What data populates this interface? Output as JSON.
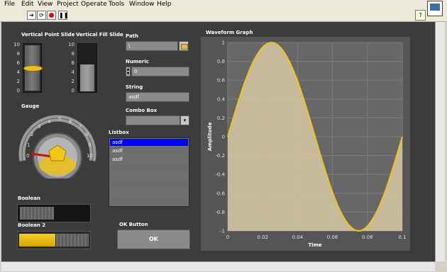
{
  "menu": [
    "File",
    "Edit",
    "View",
    "Project",
    "Operate",
    "Tools",
    "Window",
    "Help"
  ],
  "toolbar_icons": [
    "run-arrow-icon",
    "run-continuous-icon",
    "abort-icon",
    "pause-icon"
  ],
  "vertical_point_slide": {
    "label": "Vertical Point Slide",
    "ticks": [
      "10",
      "8",
      "6",
      "4",
      "2",
      "0"
    ],
    "value": 5
  },
  "vertical_fill_slide": {
    "label": "Vertical Fill Slide",
    "ticks": [
      "10",
      "8",
      "6",
      "4",
      "2",
      "0"
    ],
    "value": 6
  },
  "gauge": {
    "label": "Gauge",
    "ticks": [
      "0",
      "1",
      "2",
      "3",
      "4",
      "5",
      "6",
      "7",
      "8",
      "9",
      "10"
    ],
    "value": 1.4
  },
  "path": {
    "label": "Path",
    "value": "\\"
  },
  "numeric": {
    "label": "Numeric",
    "value": "0"
  },
  "string": {
    "label": "String",
    "value": "asdf"
  },
  "combo_box": {
    "label": "Combo Box",
    "value": ""
  },
  "listbox": {
    "label": "Listbox",
    "items": [
      "asdf",
      "asdf",
      "asdf"
    ],
    "selected_index": 0
  },
  "boolean1": {
    "label": "Boolean",
    "on": false
  },
  "boolean2": {
    "label": "Boolean 2",
    "on": true
  },
  "ok_button": {
    "label": "OK Button",
    "text": "OK"
  },
  "chart_data": {
    "type": "area",
    "title": "Waveform Graph",
    "xlabel": "Time",
    "ylabel": "Amplitude",
    "xlim": [
      0,
      0.1
    ],
    "ylim": [
      -1,
      1
    ],
    "xticks": [
      "0",
      "0.02",
      "0.04",
      "0.06",
      "0.08",
      "0.1"
    ],
    "yticks": [
      "1",
      "0.8",
      "0.6",
      "0.4",
      "0.2",
      "0",
      "-0.2",
      "-0.4",
      "-0.6",
      "-0.8",
      "-1"
    ],
    "grid": true,
    "series": [
      {
        "x": [
          0,
          0.005,
          0.01,
          0.015,
          0.02,
          0.025,
          0.03,
          0.035,
          0.04,
          0.045,
          0.05,
          0.055,
          0.06,
          0.065,
          0.07,
          0.075,
          0.08,
          0.085,
          0.09,
          0.095,
          0.1
        ],
        "values": [
          0,
          0.31,
          0.59,
          0.81,
          0.95,
          1,
          0.95,
          0.81,
          0.59,
          0.31,
          0,
          -0.31,
          -0.59,
          -0.81,
          -0.95,
          -1,
          -0.95,
          -0.81,
          -0.59,
          -0.31,
          0
        ],
        "color": "#f0c419"
      }
    ]
  }
}
